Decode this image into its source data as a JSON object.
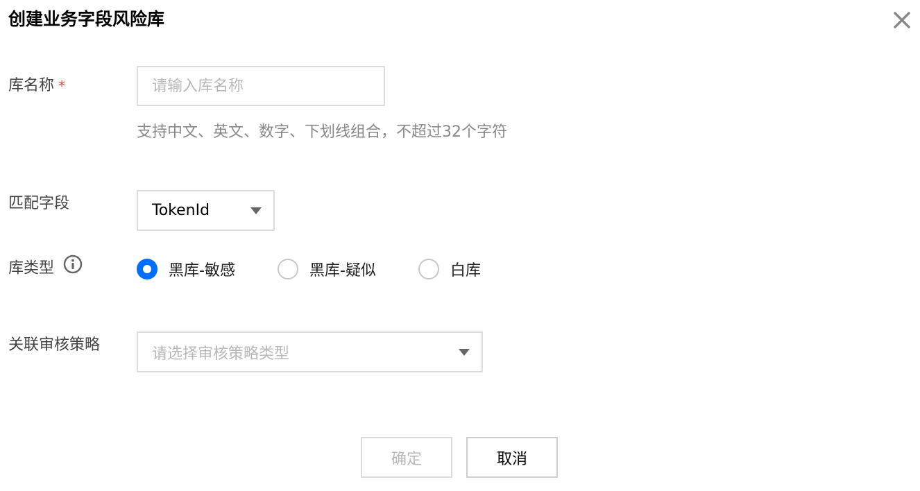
{
  "dialog": {
    "title": "创建业务字段风险库",
    "close_icon": "close-icon"
  },
  "form": {
    "name": {
      "label": "库名称",
      "required_mark": "*",
      "placeholder": "请输入库名称",
      "value": "",
      "hint": "支持中文、英文、数字、下划线组合，不超过32个字符"
    },
    "match_field": {
      "label": "匹配字段",
      "selected": "TokenId"
    },
    "lib_type": {
      "label": "库类型",
      "info_icon": "info-icon",
      "options": [
        {
          "label": "黑库-敏感",
          "checked": true
        },
        {
          "label": "黑库-疑似",
          "checked": false
        },
        {
          "label": "白库",
          "checked": false
        }
      ]
    },
    "policy": {
      "label": "关联审核策略",
      "placeholder": "请选择审核策略类型"
    }
  },
  "footer": {
    "confirm_label": "确定",
    "confirm_disabled": true,
    "cancel_label": "取消"
  },
  "colors": {
    "accent": "#006eff",
    "required": "#e54545",
    "border": "#dcdcdc",
    "placeholder": "#b8b8b8",
    "hint": "#888888"
  }
}
